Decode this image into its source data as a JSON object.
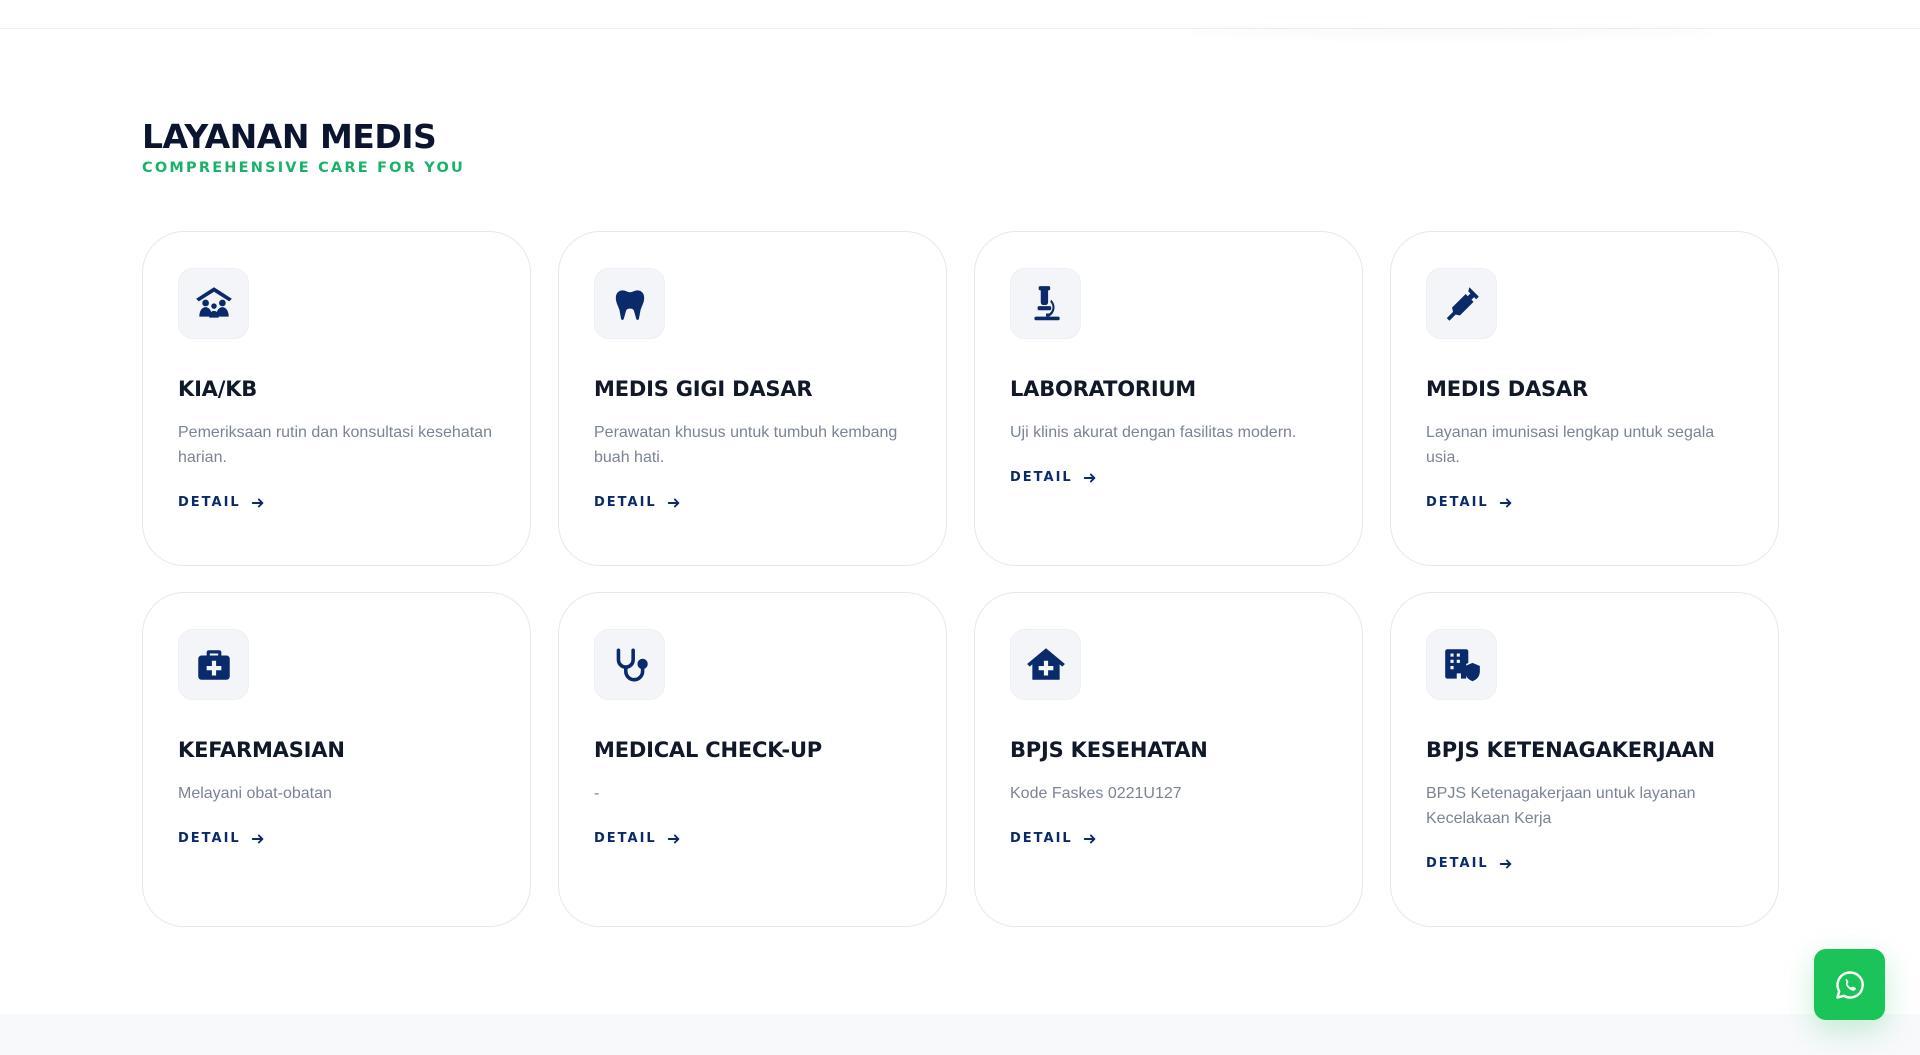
{
  "section": {
    "title": "LAYANAN MEDIS",
    "subtitle": "COMPREHENSIVE CARE FOR YOU"
  },
  "services": [
    {
      "icon": "family-shelter-icon",
      "title": "KIA/KB",
      "description": "Pemeriksaan rutin dan konsultasi kesehatan harian.",
      "link_label": "DETAIL"
    },
    {
      "icon": "tooth-icon",
      "title": "MEDIS GIGI DASAR",
      "description": "Perawatan khusus untuk tumbuh kembang buah hati.",
      "link_label": "DETAIL"
    },
    {
      "icon": "microscope-icon",
      "title": "LABORATORIUM",
      "description": "Uji klinis akurat dengan fasilitas modern.",
      "link_label": "DETAIL"
    },
    {
      "icon": "syringe-icon",
      "title": "MEDIS DASAR",
      "description": "Layanan imunisasi lengkap untuk segala usia.",
      "link_label": "DETAIL"
    },
    {
      "icon": "medical-kit-icon",
      "title": "KEFARMASIAN",
      "description": "Melayani obat-obatan",
      "link_label": "DETAIL"
    },
    {
      "icon": "stethoscope-icon",
      "title": "MEDICAL CHECK-UP",
      "description": "-",
      "link_label": "DETAIL"
    },
    {
      "icon": "house-medical-icon",
      "title": "BPJS KESEHATAN",
      "description": "Kode Faskes 0221U127",
      "link_label": "DETAIL"
    },
    {
      "icon": "building-shield-icon",
      "title": "BPJS KETENAGAKERJAAN",
      "description": "BPJS Ketenagakerjaan untuk layanan Kecelakaan Kerja",
      "link_label": "DETAIL"
    }
  ],
  "colors": {
    "accent_green": "#18b368",
    "navy": "#0b2a6b",
    "whatsapp_green": "#1bc458"
  },
  "floating": {
    "icon": "whatsapp-icon"
  }
}
